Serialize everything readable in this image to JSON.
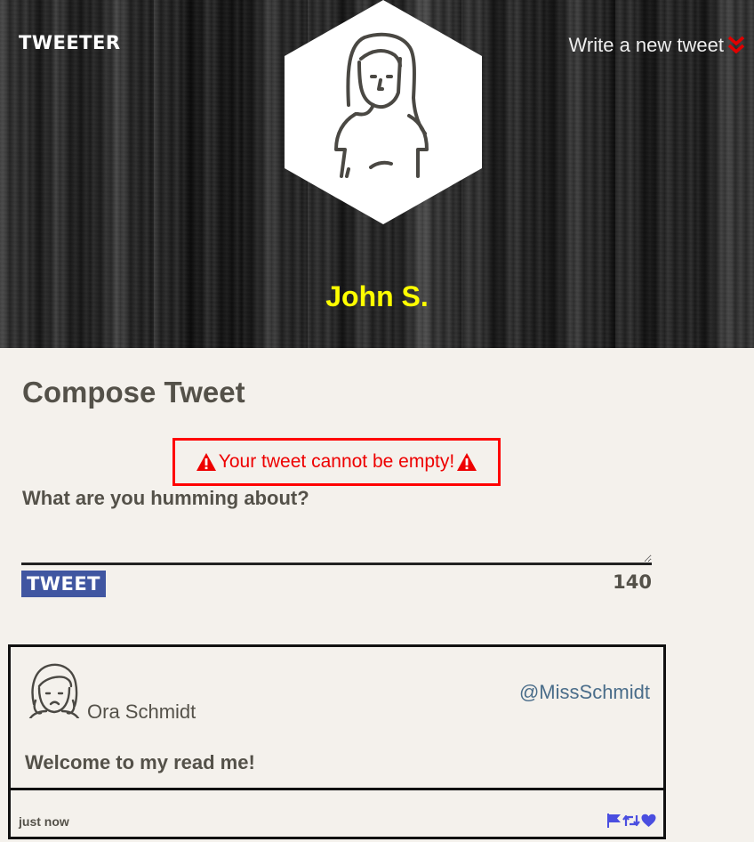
{
  "nav": {
    "brand": "TWEETER",
    "write_link": "Write a new tweet",
    "accent_color": "#e00000"
  },
  "profile": {
    "name": "John S.",
    "name_color": "#ffff00"
  },
  "compose": {
    "title": "Compose Tweet",
    "error_message": "Your tweet cannot be empty!",
    "error_color": "#ee0000",
    "prompt_label": "What are you humming about?",
    "textarea_value": "",
    "button_label": "TWEET",
    "button_color": "#4056a1",
    "char_count": "140"
  },
  "tweets": [
    {
      "author": "Ora Schmidt",
      "handle": "@MissSchmidt",
      "body": "Welcome to my read me!",
      "time": "just now",
      "actions_color": "#4a4ee0",
      "actions": [
        "flag-icon",
        "retweet-icon",
        "heart-icon"
      ]
    }
  ]
}
